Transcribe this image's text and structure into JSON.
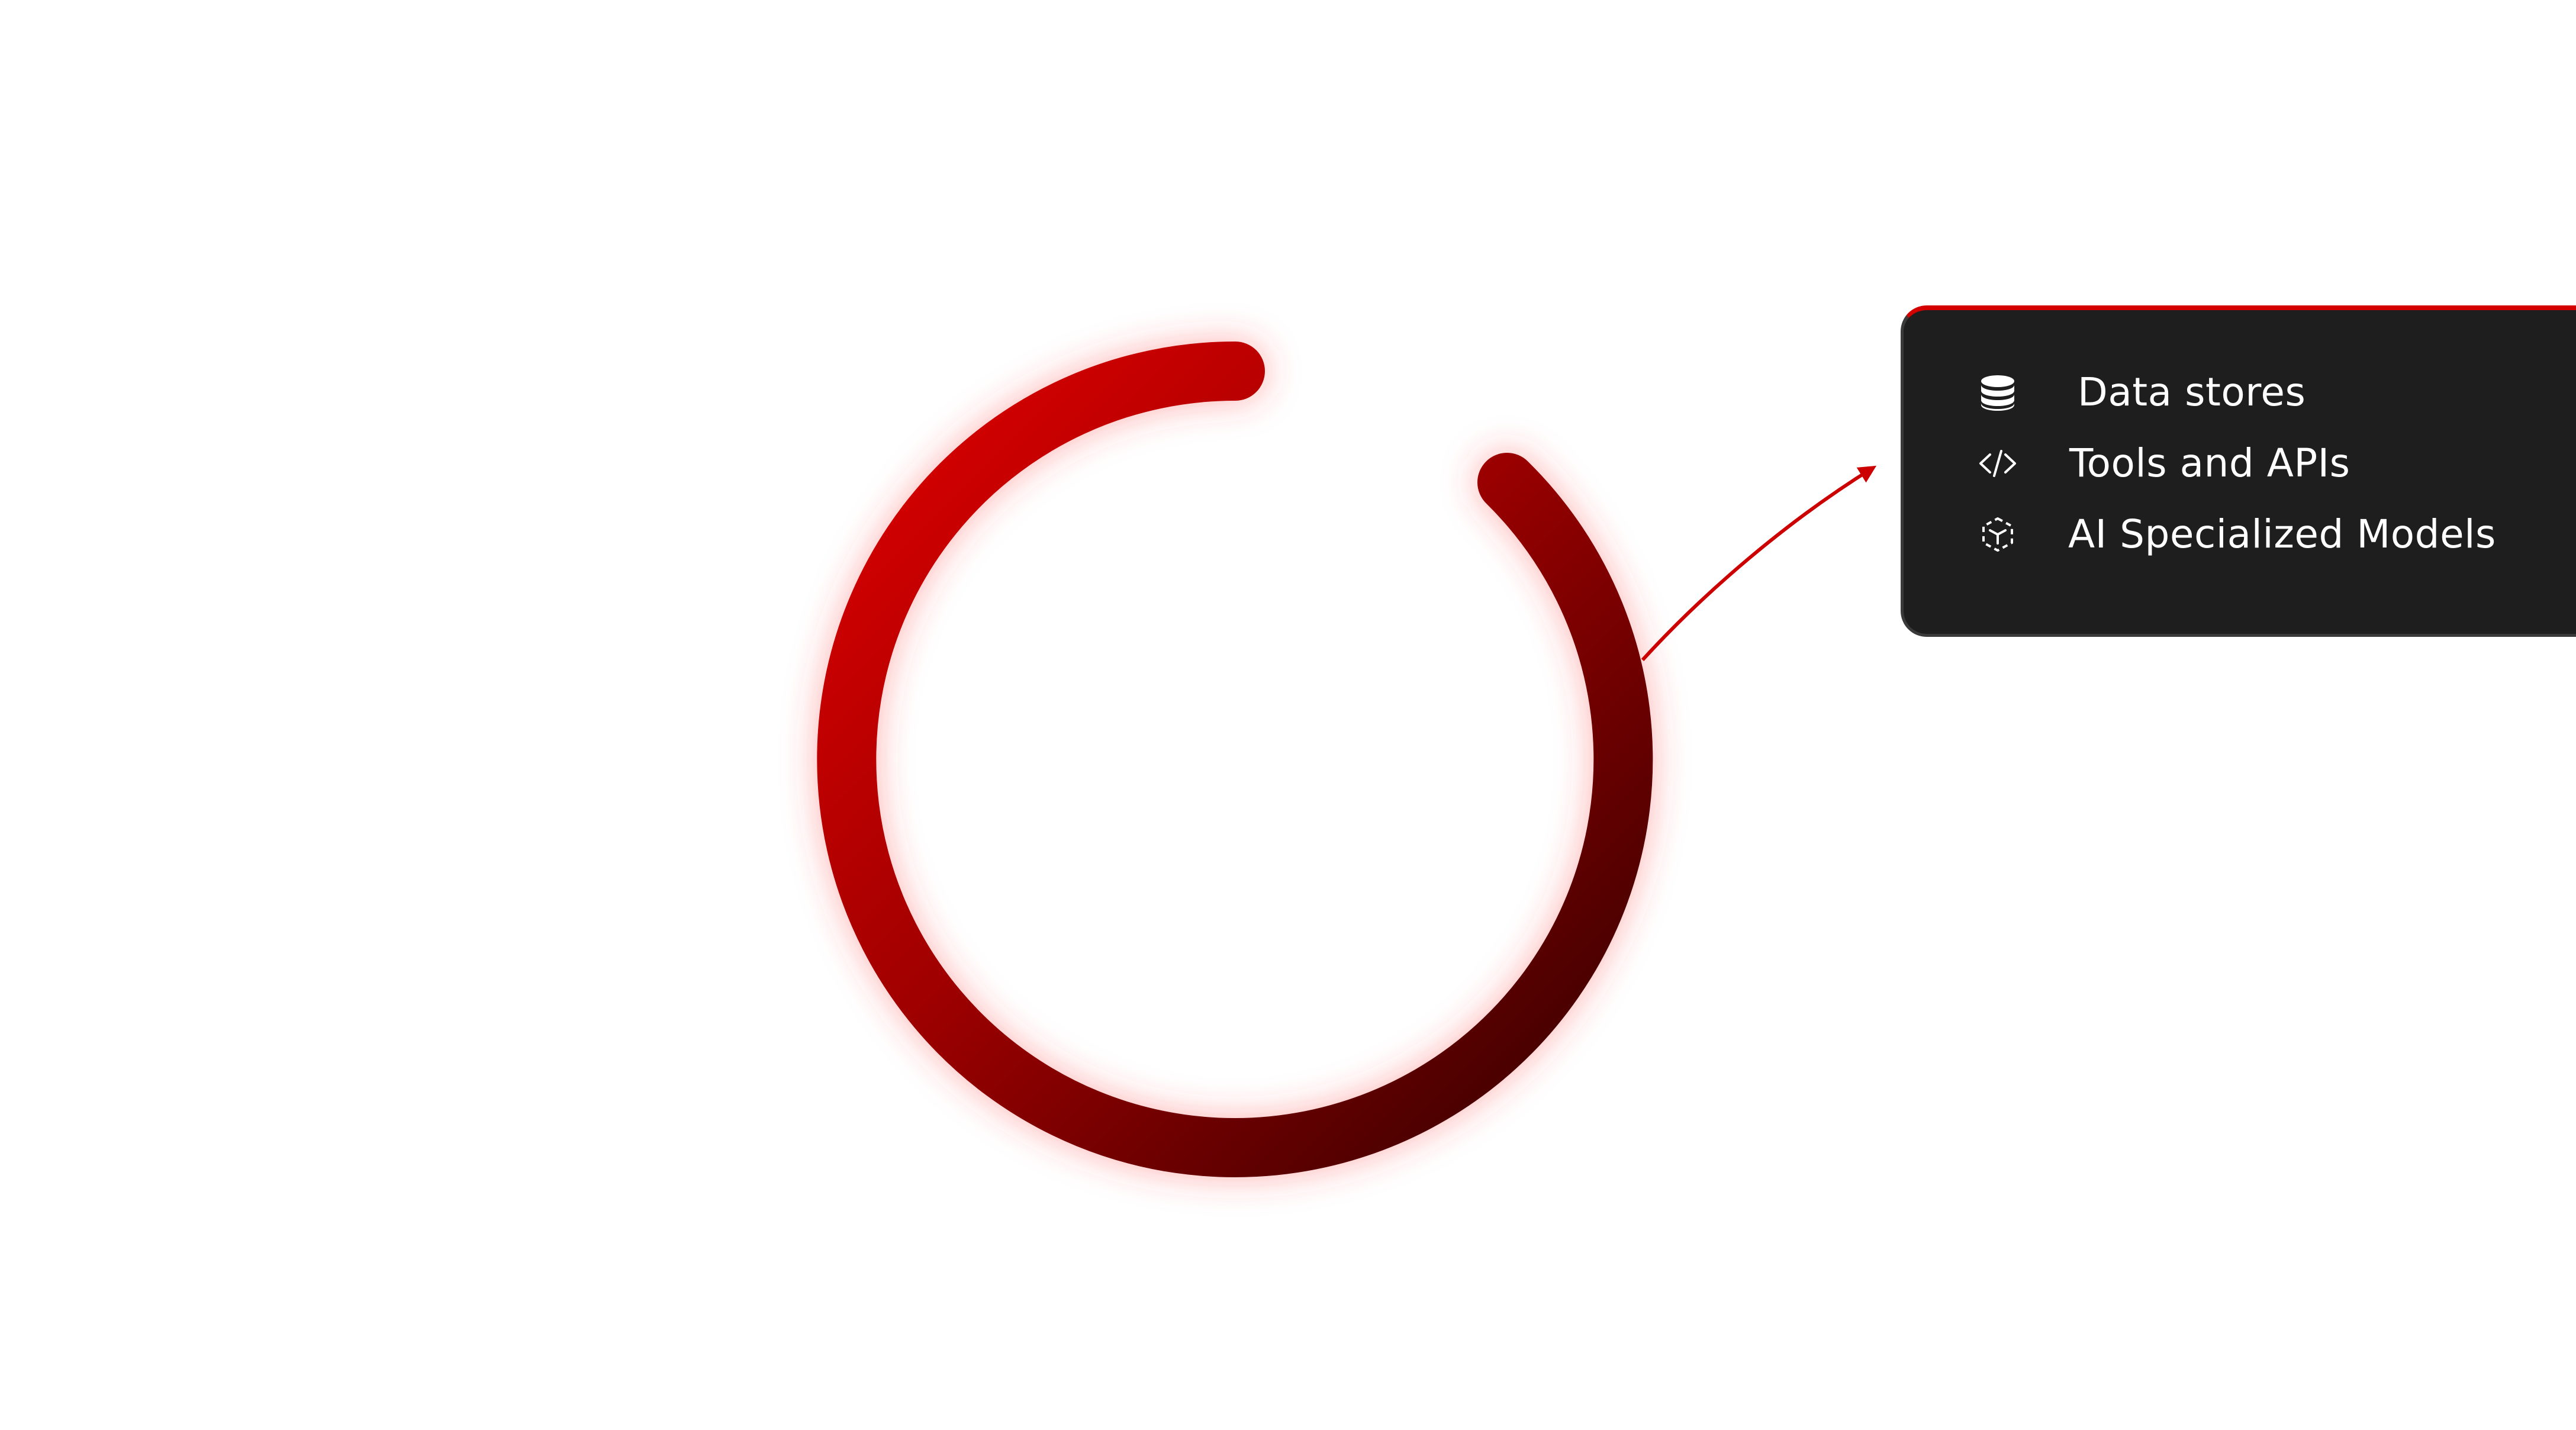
{
  "diagram": {
    "ring_colors": {
      "start": "#d40000",
      "end": "#3a0000",
      "glow": "#ff3b3b"
    },
    "arrow_color": "#cc0000",
    "card": {
      "background": "#1e1e1e",
      "accent": "#d40000",
      "items": [
        {
          "icon": "database-icon",
          "label": "Data stores"
        },
        {
          "icon": "code-icon",
          "label": "Tools and APIs"
        },
        {
          "icon": "ai-cube-icon",
          "label": "AI Specialized Models"
        }
      ]
    }
  }
}
